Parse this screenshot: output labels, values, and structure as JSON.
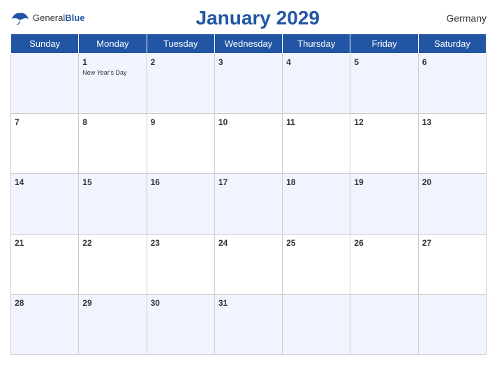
{
  "header": {
    "logo_general": "General",
    "logo_blue": "Blue",
    "title": "January 2029",
    "country": "Germany"
  },
  "weekdays": [
    "Sunday",
    "Monday",
    "Tuesday",
    "Wednesday",
    "Thursday",
    "Friday",
    "Saturday"
  ],
  "weeks": [
    [
      {
        "day": "",
        "empty": true
      },
      {
        "day": "1",
        "holiday": "New Year's Day"
      },
      {
        "day": "2"
      },
      {
        "day": "3"
      },
      {
        "day": "4"
      },
      {
        "day": "5"
      },
      {
        "day": "6"
      }
    ],
    [
      {
        "day": "7"
      },
      {
        "day": "8"
      },
      {
        "day": "9"
      },
      {
        "day": "10"
      },
      {
        "day": "11"
      },
      {
        "day": "12"
      },
      {
        "day": "13"
      }
    ],
    [
      {
        "day": "14"
      },
      {
        "day": "15"
      },
      {
        "day": "16"
      },
      {
        "day": "17"
      },
      {
        "day": "18"
      },
      {
        "day": "19"
      },
      {
        "day": "20"
      }
    ],
    [
      {
        "day": "21"
      },
      {
        "day": "22"
      },
      {
        "day": "23"
      },
      {
        "day": "24"
      },
      {
        "day": "25"
      },
      {
        "day": "26"
      },
      {
        "day": "27"
      }
    ],
    [
      {
        "day": "28"
      },
      {
        "day": "29"
      },
      {
        "day": "30"
      },
      {
        "day": "31"
      },
      {
        "day": "",
        "empty": true
      },
      {
        "day": "",
        "empty": true
      },
      {
        "day": "",
        "empty": true
      }
    ]
  ]
}
